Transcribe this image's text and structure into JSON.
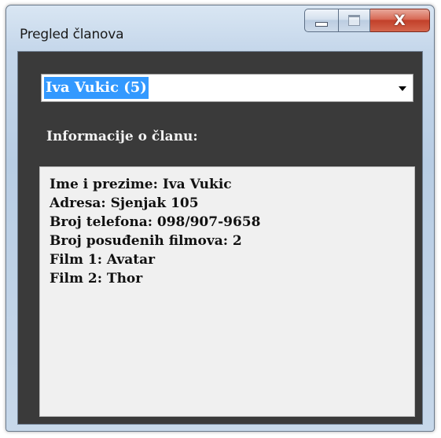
{
  "window": {
    "title": "Pregled članova",
    "minimize_glyph": "minimize-icon",
    "maximize_glyph": "maximize-icon",
    "close_glyph": "X"
  },
  "member_select": {
    "selected_value": "Iva Vukic (5)"
  },
  "info_section": {
    "label": "Informacije o članu:",
    "lines": [
      "Ime i prezime: Iva Vukic",
      "Adresa: Sjenjak 105",
      "Broj telefona: 098/907-9658",
      "Broj posuđenih filmova: 2",
      "Film 1: Avatar",
      "Film 2: Thor"
    ]
  },
  "colors": {
    "client_background": "#3a3a3a",
    "selection_highlight": "#3399ff",
    "close_button": "#c2402a"
  }
}
